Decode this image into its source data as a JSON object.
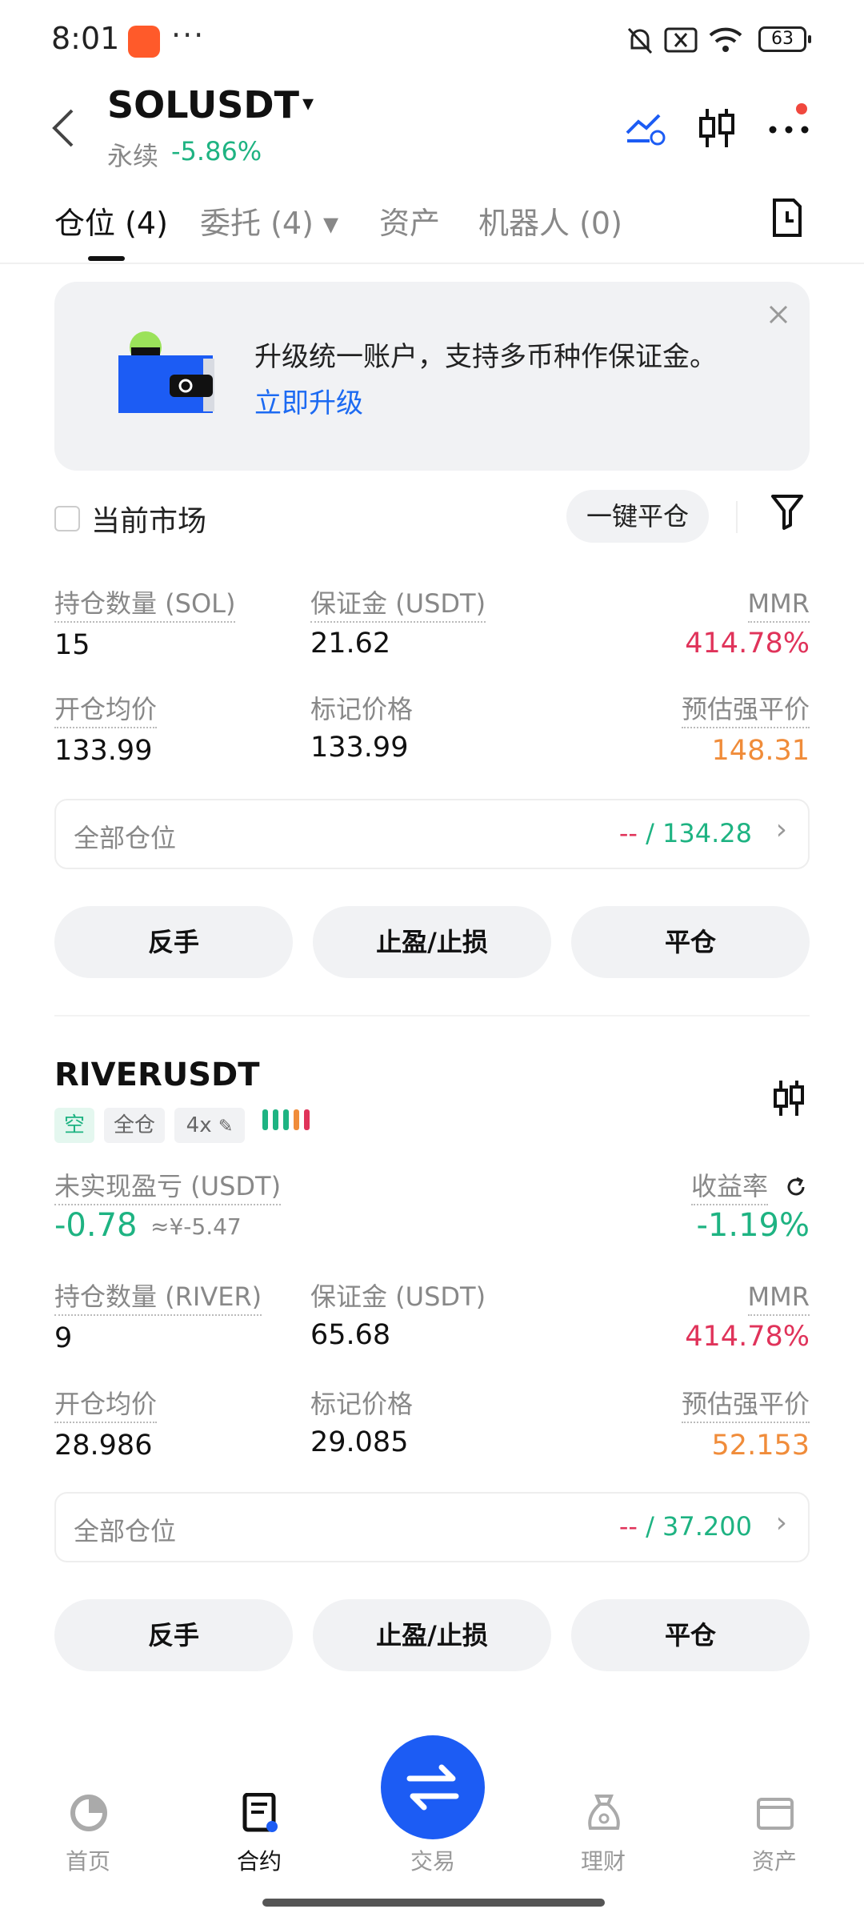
{
  "status_bar": {
    "time": "8:01",
    "dots": "···",
    "battery": "63"
  },
  "header": {
    "title": "SOLUSDT",
    "caret": "▾",
    "subtitle": "永续",
    "change": "-5.86%"
  },
  "tabs": [
    {
      "label": "仓位 (4)"
    },
    {
      "label": "委托 (4) ▾"
    },
    {
      "label": "资产"
    },
    {
      "label": "机器人 (0)"
    }
  ],
  "banner": {
    "text": "升级统一账户，支持多币种作保证金。",
    "link": "立即升级"
  },
  "filter": {
    "current_market": "当前市场",
    "close_all": "一键平仓"
  },
  "position1": {
    "qty_label": "持仓数量 (SOL)",
    "qty": "15",
    "margin_label": "保证金 (USDT)",
    "margin": "21.62",
    "mmr_label": "MMR",
    "mmr": "414.78%",
    "entry_label": "开仓均价",
    "entry": "133.99",
    "mark_label": "标记价格",
    "mark": "133.99",
    "liq_label": "预估强平价",
    "liq": "148.31",
    "all_label": "全部仓位",
    "all_dash": "--",
    "all_sep": " / ",
    "all_value": "134.28"
  },
  "actions": {
    "reverse": "反手",
    "tpsl": "止盈/止损",
    "close": "平仓"
  },
  "position2": {
    "pair": "RIVERUSDT",
    "tag_side": "空",
    "tag_mode": "全仓",
    "tag_lev": "4x",
    "pnl_label": "未实现盈亏 (USDT)",
    "pnl": "-0.78",
    "pnl_cny": "≈¥-5.47",
    "roi_label": "收益率",
    "roi": "-1.19%",
    "qty_label": "持仓数量 (RIVER)",
    "qty": "9",
    "margin_label": "保证金 (USDT)",
    "margin": "65.68",
    "mmr_label": "MMR",
    "mmr": "414.78%",
    "entry_label": "开仓均价",
    "entry": "28.986",
    "mark_label": "标记价格",
    "mark": "29.085",
    "liq_label": "预估强平价",
    "liq": "52.153",
    "all_label": "全部仓位",
    "all_dash": "--",
    "all_sep": " / ",
    "all_value": "37.200"
  },
  "bottom_nav": [
    {
      "label": "首页"
    },
    {
      "label": "合约"
    },
    {
      "label": "交易"
    },
    {
      "label": "理财"
    },
    {
      "label": "资产"
    }
  ],
  "colors": {
    "green": "#1eb382",
    "red": "#e0335a",
    "orange": "#f08c3a",
    "blue": "#1c5cf4"
  }
}
